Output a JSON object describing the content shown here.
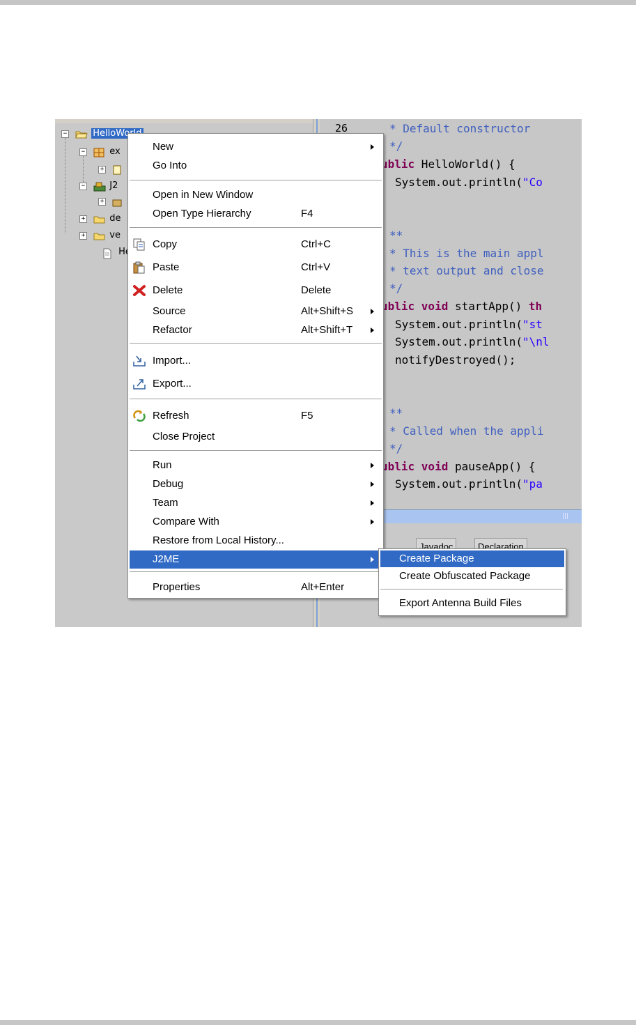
{
  "explorer": {
    "project_label": "HelloWorld",
    "rows": [
      "ex",
      "J",
      "J2",
      "",
      "de",
      "ve",
      "He"
    ]
  },
  "editor": {
    "line_number": "26",
    "lines": {
      "l1": "* Default constructor",
      "l2": "*/",
      "l3_kw": "ublic",
      "l3_rest": " HelloWorld() {",
      "l4_a": "System.out.println(",
      "l4_s": "\"Co",
      "l5": "**",
      "l6": "* This is the main appl",
      "l7": "* text output and close",
      "l8": "*/",
      "l9_kw": "ublic void",
      "l9_rest": " startApp() ",
      "l9_kw2": "th",
      "l10_a": "System.out.println(",
      "l10_s": "\"st",
      "l11_a": "System.out.println(",
      "l11_s": "\"\\nl",
      "l12": "notifyDestroyed();",
      "l13": "**",
      "l14": "* Called when the appli",
      "l15": "*/",
      "l16_kw": "ublic void",
      "l16_rest": " pauseApp() {",
      "l17_a": "System.out.println(",
      "l17_s": "\"pa"
    },
    "scroll_grip": "|||"
  },
  "bottom_tabs": {
    "javadoc": "Javadoc",
    "declaration": "Declaration"
  },
  "menu": {
    "new": "New",
    "go_into": "Go Into",
    "open_new_window": "Open in New Window",
    "open_type_hierarchy": "Open Type Hierarchy",
    "open_type_hierarchy_accel": "F4",
    "copy": "Copy",
    "copy_accel": "Ctrl+C",
    "paste": "Paste",
    "paste_accel": "Ctrl+V",
    "delete": "Delete",
    "delete_accel": "Delete",
    "source": "Source",
    "source_accel": "Alt+Shift+S",
    "refactor": "Refactor",
    "refactor_accel": "Alt+Shift+T",
    "import": "Import...",
    "export": "Export...",
    "refresh": "Refresh",
    "refresh_accel": "F5",
    "close_project": "Close Project",
    "run": "Run",
    "debug": "Debug",
    "team": "Team",
    "compare_with": "Compare With",
    "restore_history": "Restore from Local History...",
    "j2me": "J2ME",
    "properties": "Properties",
    "properties_accel": "Alt+Enter"
  },
  "submenu": {
    "create_package": "Create Package",
    "create_obfuscated": "Create Obfuscated Package",
    "export_antenna": "Export Antenna Build Files"
  },
  "colors": {
    "selection": "#316ac5",
    "comment": "#3f5fbf",
    "keyword": "#7f0055",
    "string": "#2a00ff"
  }
}
